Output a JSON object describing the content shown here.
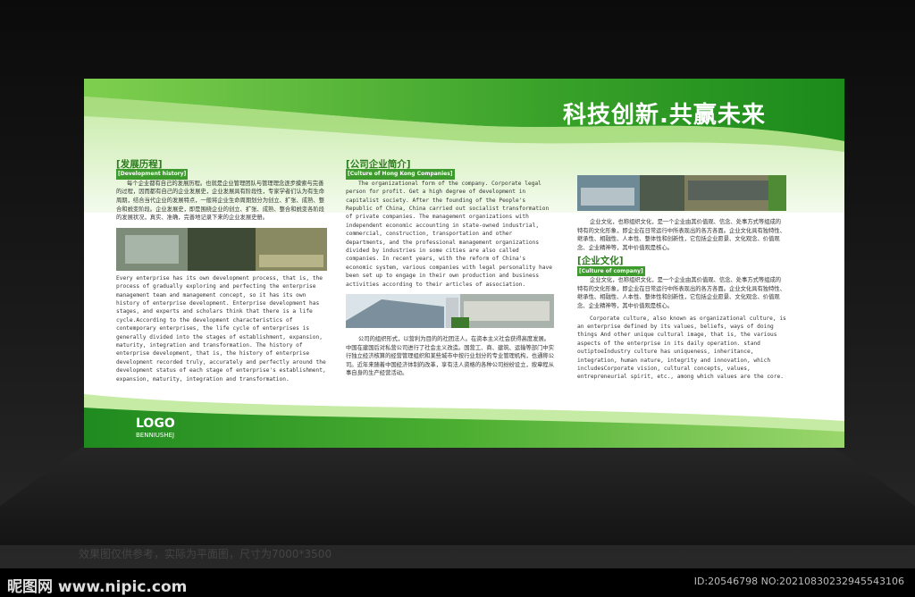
{
  "slogan": "科技创新.共赢未来",
  "left": {
    "title": "[发展历程]",
    "subtitle": "[Development history]",
    "cn_text": "每个企业都有自己的发展历程。也就是企业管理团队与管理理念逐步摸索与完善的过程，因而都有自己的企业发展史，企业发展具有阶段性，专家学者们认为有生命周期，结合当代企业的发展特点，一般将企业生命周期划分为创立、扩张、成熟、整合和蜕变阶段。企业发展史，即是围绕企业的创立、扩张、成熟、整合和蜕变各阶段的发展状况，真实、准确，完善地记录下来的企业发展史册。",
    "en_text": "Every enterprise has its own development process, that is, the process of gradually exploring and perfecting the enterprise management team and management concept, so it has its own history of enterprise development. Enterprise development has stages, and experts and scholars think that there is a life cycle.According to the development characteristics of contemporary enterprises, the life cycle of enterprises is generally divided into the stages of establishment, expansion, maturity, integration and transformation. The history of enterprise development, that is, the history of enterprise development recorded truly, accurately and perfectly around the development status of each stage of enterprise's establishment, expansion, maturity, integration and transformation."
  },
  "middle": {
    "title": "[公司企业简介]",
    "subtitle": "[Culture of Hong Kong Companies]",
    "en_text": "The organizational form of the company. Corporate legal person for profit. Get a high degree of development in capitalist society. After the founding of the People's Republic of China, China carried out socialist transformation of private companies. The management organizations with independent economic accounting in state-owned industrial, commercial, construction, transportation and other departments, and the professional management organizations divided by industries in some cities are also called companies. In recent years, with the reform of China's economic system, various companies with legal personality have been set up to engage in their own production and business activities according to their articles of association.",
    "cn_text": "公司的组织形式，以营利为目的的社团法人。在资本主义社会获得高度发展。中国在建国后对私营公司进行了社会主义改造。国营工、商、建筑、运输等部门中实行独立经济核算的经营管理组织和某些城市中按行业划分的专业管理机构，也通称公司。近年来随着中国经济体制的改革，享有法人资格的各种公司纷纷设立，按章程从事自身的生产经营活动。"
  },
  "right": {
    "cn_text_1": "企业文化，也称组织文化，是一个企业由其价值观、信念、处事方式等组成的特有的文化形象，即企业在日常运行中所表现出的各方各面。企业文化具有独特性、继承性、相融性、人本性、整体性和创新性，它包括企业愿景、文化观念、价值观念、企业精神等，其中价值观是核心。",
    "title": "[企业文化]",
    "subtitle": "[Culture of company]",
    "cn_text_2": "企业文化，也称组织文化，是一个企业由其价值观、信念、处事方式等组成的特有的文化形象，即企业在日常运行中所表现出的各方各面。企业文化具有独特性、继承性、相融性、人本性、整体性和创新性，它包括企业愿景、文化观念、价值观念、企业精神等，其中价值观是核心。",
    "en_text": "Corporate culture, also known as organizational culture, is an enterprise defined by its values, beliefs, ways of doing things And other unique cultural image, that is, the various aspects of the enterprise in its daily operation. stand outiptoeIndustry culture has uniqueness, inheritance, integration, human nature, integrity and innovation, which includesCorporate vision, cultural concepts, values, entrepreneurial spirit, etc., among which values are the core."
  },
  "logo": {
    "text": "LOGO",
    "sub": "BENNIUSHEJ"
  },
  "caption": "效果图仅供参考，实际为平面图，尺寸为7000*3500",
  "watermark": {
    "site": "昵图网 www.nipic.com",
    "id": "ID:20546798 NO:20210830232945543106"
  },
  "colors": {
    "green_dark": "#1f8a1f",
    "green_light": "#a8dd7a",
    "accent": "#3d9a2c"
  }
}
